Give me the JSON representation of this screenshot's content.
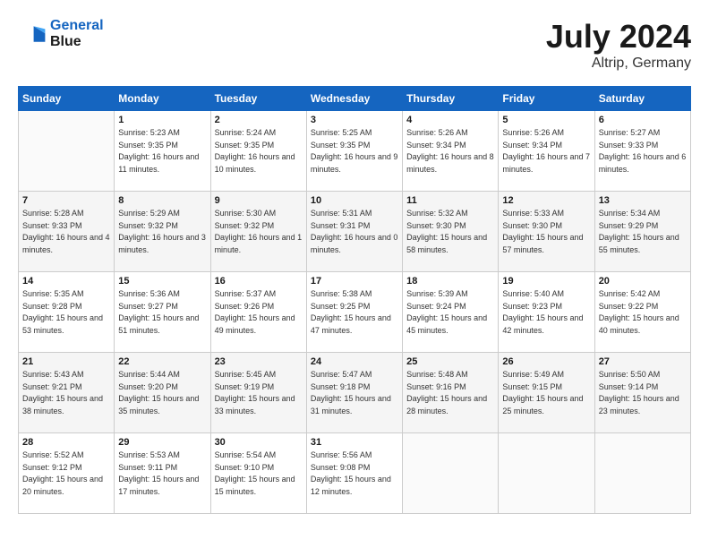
{
  "header": {
    "logo_line1": "General",
    "logo_line2": "Blue",
    "month_year": "July 2024",
    "location": "Altrip, Germany"
  },
  "weekdays": [
    "Sunday",
    "Monday",
    "Tuesday",
    "Wednesday",
    "Thursday",
    "Friday",
    "Saturday"
  ],
  "weeks": [
    [
      {
        "day": "",
        "sunrise": "",
        "sunset": "",
        "daylight": ""
      },
      {
        "day": "1",
        "sunrise": "Sunrise: 5:23 AM",
        "sunset": "Sunset: 9:35 PM",
        "daylight": "Daylight: 16 hours and 11 minutes."
      },
      {
        "day": "2",
        "sunrise": "Sunrise: 5:24 AM",
        "sunset": "Sunset: 9:35 PM",
        "daylight": "Daylight: 16 hours and 10 minutes."
      },
      {
        "day": "3",
        "sunrise": "Sunrise: 5:25 AM",
        "sunset": "Sunset: 9:35 PM",
        "daylight": "Daylight: 16 hours and 9 minutes."
      },
      {
        "day": "4",
        "sunrise": "Sunrise: 5:26 AM",
        "sunset": "Sunset: 9:34 PM",
        "daylight": "Daylight: 16 hours and 8 minutes."
      },
      {
        "day": "5",
        "sunrise": "Sunrise: 5:26 AM",
        "sunset": "Sunset: 9:34 PM",
        "daylight": "Daylight: 16 hours and 7 minutes."
      },
      {
        "day": "6",
        "sunrise": "Sunrise: 5:27 AM",
        "sunset": "Sunset: 9:33 PM",
        "daylight": "Daylight: 16 hours and 6 minutes."
      }
    ],
    [
      {
        "day": "7",
        "sunrise": "Sunrise: 5:28 AM",
        "sunset": "Sunset: 9:33 PM",
        "daylight": "Daylight: 16 hours and 4 minutes."
      },
      {
        "day": "8",
        "sunrise": "Sunrise: 5:29 AM",
        "sunset": "Sunset: 9:32 PM",
        "daylight": "Daylight: 16 hours and 3 minutes."
      },
      {
        "day": "9",
        "sunrise": "Sunrise: 5:30 AM",
        "sunset": "Sunset: 9:32 PM",
        "daylight": "Daylight: 16 hours and 1 minute."
      },
      {
        "day": "10",
        "sunrise": "Sunrise: 5:31 AM",
        "sunset": "Sunset: 9:31 PM",
        "daylight": "Daylight: 16 hours and 0 minutes."
      },
      {
        "day": "11",
        "sunrise": "Sunrise: 5:32 AM",
        "sunset": "Sunset: 9:30 PM",
        "daylight": "Daylight: 15 hours and 58 minutes."
      },
      {
        "day": "12",
        "sunrise": "Sunrise: 5:33 AM",
        "sunset": "Sunset: 9:30 PM",
        "daylight": "Daylight: 15 hours and 57 minutes."
      },
      {
        "day": "13",
        "sunrise": "Sunrise: 5:34 AM",
        "sunset": "Sunset: 9:29 PM",
        "daylight": "Daylight: 15 hours and 55 minutes."
      }
    ],
    [
      {
        "day": "14",
        "sunrise": "Sunrise: 5:35 AM",
        "sunset": "Sunset: 9:28 PM",
        "daylight": "Daylight: 15 hours and 53 minutes."
      },
      {
        "day": "15",
        "sunrise": "Sunrise: 5:36 AM",
        "sunset": "Sunset: 9:27 PM",
        "daylight": "Daylight: 15 hours and 51 minutes."
      },
      {
        "day": "16",
        "sunrise": "Sunrise: 5:37 AM",
        "sunset": "Sunset: 9:26 PM",
        "daylight": "Daylight: 15 hours and 49 minutes."
      },
      {
        "day": "17",
        "sunrise": "Sunrise: 5:38 AM",
        "sunset": "Sunset: 9:25 PM",
        "daylight": "Daylight: 15 hours and 47 minutes."
      },
      {
        "day": "18",
        "sunrise": "Sunrise: 5:39 AM",
        "sunset": "Sunset: 9:24 PM",
        "daylight": "Daylight: 15 hours and 45 minutes."
      },
      {
        "day": "19",
        "sunrise": "Sunrise: 5:40 AM",
        "sunset": "Sunset: 9:23 PM",
        "daylight": "Daylight: 15 hours and 42 minutes."
      },
      {
        "day": "20",
        "sunrise": "Sunrise: 5:42 AM",
        "sunset": "Sunset: 9:22 PM",
        "daylight": "Daylight: 15 hours and 40 minutes."
      }
    ],
    [
      {
        "day": "21",
        "sunrise": "Sunrise: 5:43 AM",
        "sunset": "Sunset: 9:21 PM",
        "daylight": "Daylight: 15 hours and 38 minutes."
      },
      {
        "day": "22",
        "sunrise": "Sunrise: 5:44 AM",
        "sunset": "Sunset: 9:20 PM",
        "daylight": "Daylight: 15 hours and 35 minutes."
      },
      {
        "day": "23",
        "sunrise": "Sunrise: 5:45 AM",
        "sunset": "Sunset: 9:19 PM",
        "daylight": "Daylight: 15 hours and 33 minutes."
      },
      {
        "day": "24",
        "sunrise": "Sunrise: 5:47 AM",
        "sunset": "Sunset: 9:18 PM",
        "daylight": "Daylight: 15 hours and 31 minutes."
      },
      {
        "day": "25",
        "sunrise": "Sunrise: 5:48 AM",
        "sunset": "Sunset: 9:16 PM",
        "daylight": "Daylight: 15 hours and 28 minutes."
      },
      {
        "day": "26",
        "sunrise": "Sunrise: 5:49 AM",
        "sunset": "Sunset: 9:15 PM",
        "daylight": "Daylight: 15 hours and 25 minutes."
      },
      {
        "day": "27",
        "sunrise": "Sunrise: 5:50 AM",
        "sunset": "Sunset: 9:14 PM",
        "daylight": "Daylight: 15 hours and 23 minutes."
      }
    ],
    [
      {
        "day": "28",
        "sunrise": "Sunrise: 5:52 AM",
        "sunset": "Sunset: 9:12 PM",
        "daylight": "Daylight: 15 hours and 20 minutes."
      },
      {
        "day": "29",
        "sunrise": "Sunrise: 5:53 AM",
        "sunset": "Sunset: 9:11 PM",
        "daylight": "Daylight: 15 hours and 17 minutes."
      },
      {
        "day": "30",
        "sunrise": "Sunrise: 5:54 AM",
        "sunset": "Sunset: 9:10 PM",
        "daylight": "Daylight: 15 hours and 15 minutes."
      },
      {
        "day": "31",
        "sunrise": "Sunrise: 5:56 AM",
        "sunset": "Sunset: 9:08 PM",
        "daylight": "Daylight: 15 hours and 12 minutes."
      },
      {
        "day": "",
        "sunrise": "",
        "sunset": "",
        "daylight": ""
      },
      {
        "day": "",
        "sunrise": "",
        "sunset": "",
        "daylight": ""
      },
      {
        "day": "",
        "sunrise": "",
        "sunset": "",
        "daylight": ""
      }
    ]
  ]
}
